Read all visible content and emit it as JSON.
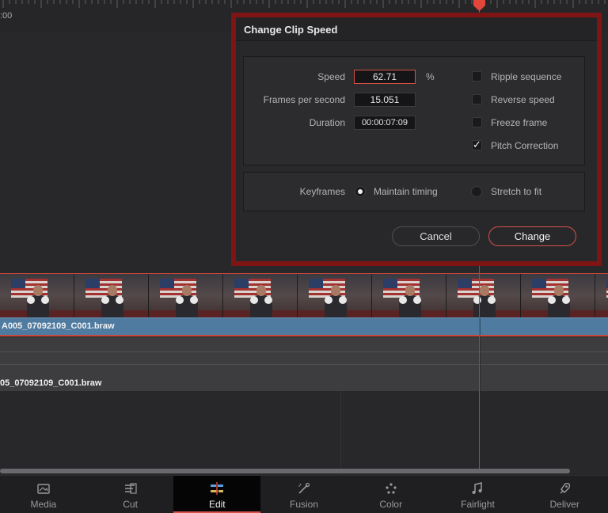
{
  "timeline": {
    "ruler_timecode": ":00",
    "video_clip_name": "A005_07092109_C001.braw",
    "audio_clip_name": "05_07092109_C001.braw"
  },
  "dialog": {
    "title": "Change Clip Speed",
    "fields": {
      "speed_label": "Speed",
      "speed_value": "62.71",
      "speed_unit": "%",
      "fps_label": "Frames per second",
      "fps_value": "15.051",
      "duration_label": "Duration",
      "duration_value": "00:00:07:09"
    },
    "options": [
      {
        "label": "Ripple sequence",
        "checked": false
      },
      {
        "label": "Reverse speed",
        "checked": false
      },
      {
        "label": "Freeze frame",
        "checked": false
      },
      {
        "label": "Pitch Correction",
        "checked": true
      }
    ],
    "check_glyph": "✓",
    "keyframes": {
      "label": "Keyframes",
      "maintain_timing": "Maintain timing",
      "stretch_to_fit": "Stretch to fit",
      "selected": "maintain_timing"
    },
    "cancel_label": "Cancel",
    "change_label": "Change"
  },
  "page_tabs": [
    {
      "label": "Media",
      "icon": "media-icon",
      "active": false
    },
    {
      "label": "Cut",
      "icon": "cut-icon",
      "active": false
    },
    {
      "label": "Edit",
      "icon": "edit-icon",
      "active": true
    },
    {
      "label": "Fusion",
      "icon": "fusion-icon",
      "active": false
    },
    {
      "label": "Color",
      "icon": "color-icon",
      "active": false
    },
    {
      "label": "Fairlight",
      "icon": "fairlight-icon",
      "active": false
    },
    {
      "label": "Deliver",
      "icon": "deliver-icon",
      "active": false
    }
  ],
  "colors": {
    "accent_red": "#d55148",
    "highlight_border": "#7e1414",
    "video_clip_blue": "#4f7ba1",
    "playhead": "#c43a30"
  }
}
